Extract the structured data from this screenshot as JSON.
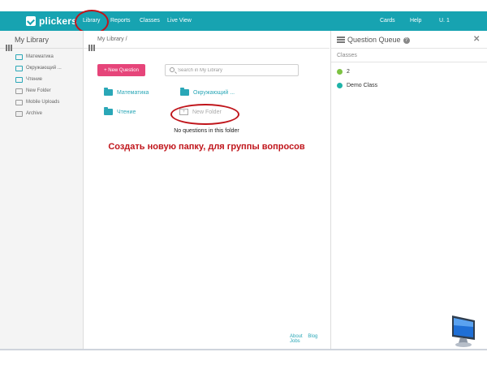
{
  "app": {
    "logo_text": "plickers"
  },
  "nav": {
    "library": "Library",
    "reports": "Reports",
    "classes": "Classes",
    "live_view": "Live View",
    "cards": "Cards",
    "help": "Help",
    "user": "U. 1"
  },
  "sidebar": {
    "title": "My Library",
    "items": [
      {
        "label": "Математика",
        "icon": "folder-icon"
      },
      {
        "label": "Окружающий ...",
        "icon": "folder-icon"
      },
      {
        "label": "Чтение",
        "icon": "folder-icon"
      },
      {
        "label": "New Folder",
        "icon": "new-folder-icon"
      },
      {
        "label": "Mobile Uploads",
        "icon": "upload-icon"
      },
      {
        "label": "Archive",
        "icon": "archive-icon"
      }
    ]
  },
  "main": {
    "breadcrumb": "My Library  /",
    "new_question_label": "+ New Question",
    "search_placeholder": "Search in My Library",
    "folders": [
      {
        "label": "Математика"
      },
      {
        "label": "Окружающий ..."
      },
      {
        "label": "Чтение"
      }
    ],
    "new_folder_label": "New Folder",
    "empty_message": "No questions in this folder",
    "caption": "Создать новую папку, для группы вопросов",
    "footer": {
      "about": "About",
      "blog": "Blog",
      "jobs": "Jobs"
    }
  },
  "queue": {
    "title": "Question Queue",
    "help_glyph": "?",
    "close_glyph": "✕",
    "classes_label": "Classes",
    "classes": [
      {
        "label": "2",
        "color": "#7dc242"
      },
      {
        "label": "Demo Class",
        "color": "#1fb3a8"
      }
    ]
  },
  "colors": {
    "brand": "#17a3b1",
    "accent_pink": "#e6457a",
    "annotation_red": "#c0151b",
    "folder_teal": "#2aa7b7"
  }
}
